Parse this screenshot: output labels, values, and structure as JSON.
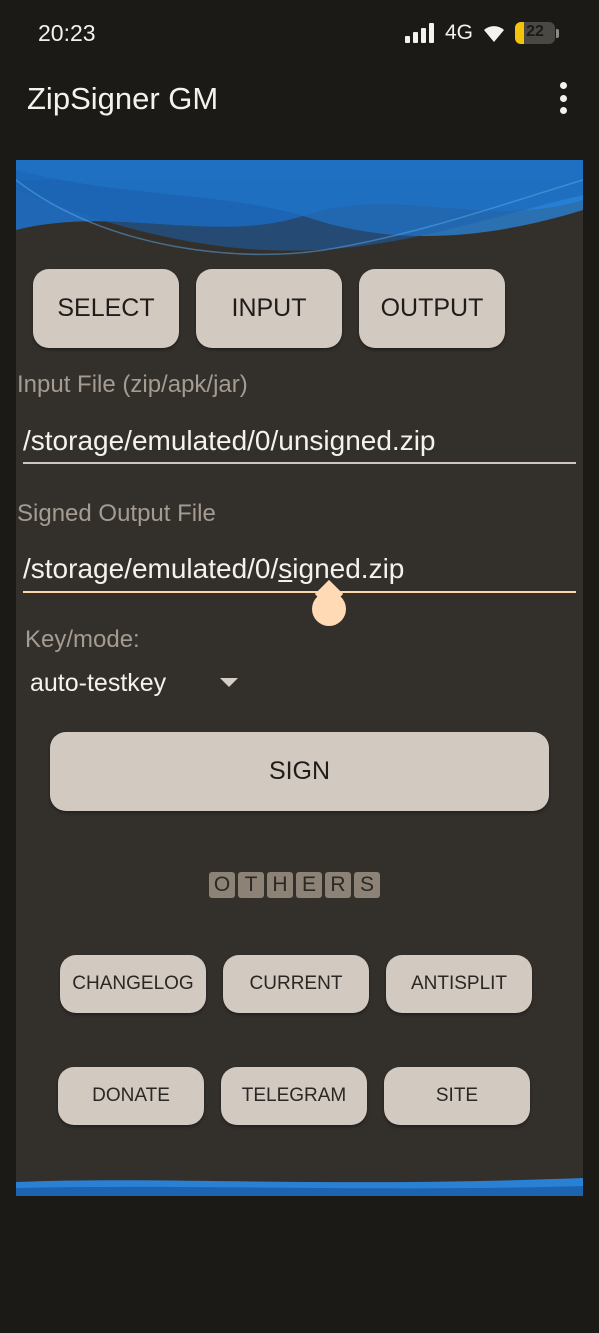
{
  "status_bar": {
    "time": "20:23",
    "network": "4G",
    "battery_level": "22",
    "battery_fraction": 0.22,
    "signal_icon": "signal-bars-icon",
    "wifi_icon": "wifi-icon",
    "battery_icon": "battery-icon"
  },
  "app_bar": {
    "title": "ZipSigner GM",
    "menu_icon": "more-vert-icon"
  },
  "top_buttons": {
    "select": "SELECT",
    "input": "INPUT",
    "output": "OUTPUT"
  },
  "input_file": {
    "label": "Input File (zip/apk/jar)",
    "value": "/storage/emulated/0/unsigned.zip"
  },
  "output_file": {
    "label": "Signed Output File",
    "value_before_cursor": "/storage/emulated/0/",
    "value_cursor_char": "s",
    "value_after_cursor": "igned.zip"
  },
  "key_mode": {
    "label": "Key/mode:",
    "selected": "auto-testkey"
  },
  "sign_button": "SIGN",
  "others_letters": [
    "O",
    "T",
    "H",
    "E",
    "R",
    "S"
  ],
  "others_buttons": {
    "changelog": "CHANGELOG",
    "current": "CURRENT",
    "antisplit": "ANTISPLIT",
    "donate": "DONATE",
    "telegram": "TELEGRAM",
    "site": "SITE"
  },
  "colors": {
    "background": "#1c1a17",
    "card": "#33302c",
    "button": "#d2c9c0",
    "accent_blue": "#2a86dc",
    "cursor_accent": "#ffd6a8",
    "battery_yellow": "#f4c40b"
  }
}
